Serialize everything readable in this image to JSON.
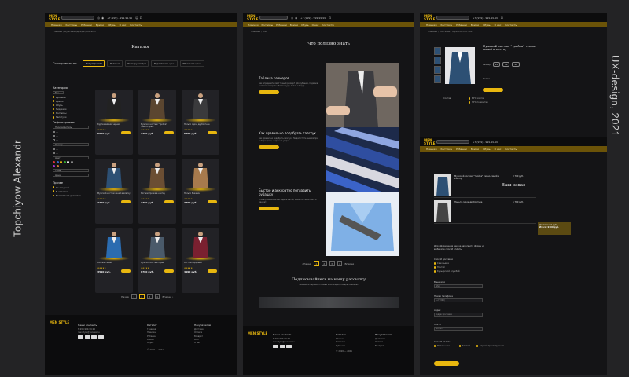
{
  "author": "Topchiyow Alexandr",
  "caption": "UX-design, 2021",
  "header": {
    "logo": "MEN STYLE",
    "phone": "+7 (999) - 999-99-99",
    "nav": [
      "Новинки",
      "Костюмы",
      "Рубашки",
      "Брюки",
      "Обувь",
      "О нас",
      "Контакты"
    ]
  },
  "catalog": {
    "breadcrumb": "Главная  /  Мужская одежда  /  Каталог",
    "title": "Каталог",
    "sort_label": "Сортировать по:",
    "sort_options": [
      "Популярности",
      "Новизне",
      "Размеру скидки",
      "Нарастанию цены",
      "Убыванию цены"
    ],
    "filters": {
      "category_title": "Категория",
      "categories": [
        "Все",
        "Рубашки",
        "Брюки",
        "Обувь",
        "Пиджаки",
        "Костюмы",
        "Галстуки"
      ],
      "sort_title": "Отфильтровать",
      "blocks": [
        "Производитель",
        "Размер",
        "Цвет",
        "Ткань",
        "Цена"
      ],
      "extra_title": "Прочее",
      "extra": [
        "Со скидкой",
        "В наличии",
        "Бесплатная доставка"
      ]
    },
    "products": [
      {
        "name": "Куртка зимняя черная",
        "price": "5690 руб."
      },
      {
        "name": "Мужской костюм \"тройка\" темно-серый",
        "price": "3200 руб."
      },
      {
        "name": "Пальто серое двубортное",
        "price": "5490 руб."
      },
      {
        "name": "Мужской костюм синий в клетку",
        "price": "4490 руб."
      },
      {
        "name": "Костюм тройка в клетку",
        "price": "3790 руб."
      },
      {
        "name": "Пальто бежевое",
        "price": "3790 руб."
      },
      {
        "name": "Костюм синий",
        "price": "3590 руб."
      },
      {
        "name": "Мужской костюм серый",
        "price": "8790 руб."
      },
      {
        "name": "Костюм бордовый",
        "price": "4990 руб."
      }
    ],
    "pager": {
      "prev": "Назад",
      "pages": [
        "1",
        "2",
        "3",
        "4"
      ],
      "active": "2",
      "next": "Вперед"
    }
  },
  "knowledge": {
    "breadcrumb": "Главная  /  Блог",
    "title": "Что полезно знать",
    "articles": [
      {
        "title": "Таблица размеров",
        "text": "Как определить свой точный размер? Для рубашки, пиджака, костюма измерьте обхват груди, талии и бедер.",
        "button": "Подробнее"
      },
      {
        "title": "Как правильно подобрать галстук",
        "text": "Как правильно подобрать галстук? Не допустите ошибок при выборе цвета, ширины и узора.",
        "button": "Подробнее"
      },
      {
        "title": "Быстро и аккуратно погладить рубашку",
        "text": "Чтобы рубашка не выглядела мятой, начните с воротника и манжет.",
        "button": "Подробнее"
      }
    ],
    "pager": {
      "prev": "Назад",
      "pages": [
        "1",
        "2",
        "3",
        "4"
      ],
      "next": "Вперед"
    },
    "subscribe_title": "Подписывайтесь на нашу рассылку",
    "subscribe_text": "Узнавайте первыми о новых коллекциях, скидках и акциях"
  },
  "product": {
    "breadcrumb": "Главная  /  Костюмы  /  Мужской костюм",
    "name": "Мужской костюм \"тройка\" темно-синий в клетку",
    "size_label": "Размер",
    "sizes": [
      "44",
      "46",
      "48"
    ],
    "qty_label": "Кол-во",
    "composition_label": "Состав",
    "composition": [
      "65% хлопок",
      "35% полиэстер"
    ]
  },
  "order": {
    "title": "Ваш заказ",
    "items": [
      {
        "name": "Мужской костюм \"тройка\" темно-синий в клетку",
        "price": "3 700 руб."
      },
      {
        "name": "Пальто серое двубортное",
        "price": "5 760 руб."
      }
    ],
    "delivery": "Доставка: 0 руб.",
    "total": "Итого: 9460 руб.",
    "form_intro": "Для оформления заказа заполните форму и выберите способ оплаты",
    "delivery_title": "Способ доставки",
    "delivery_options": [
      "Самовывоз",
      "Почтой",
      "Курьерской службой"
    ],
    "fields": [
      {
        "label": "Ваше имя",
        "placeholder": "Имя"
      },
      {
        "label": "Номер телефона",
        "placeholder": "+7 (999)"
      },
      {
        "label": "Адрес",
        "placeholder": "Адрес доставки"
      },
      {
        "label": "Почта",
        "placeholder": "e-mail"
      }
    ],
    "payment_title": "Способ оплаты",
    "payment_options": [
      "Наличными",
      "Картой",
      "Картой при получении"
    ]
  },
  "footer": {
    "contacts_title": "Наши контакты",
    "phone": "8-999-999-99-99",
    "email": "menstyle@yandex.ru",
    "catalog_title": "Каталог",
    "catalog_items": [
      "Главная",
      "Новинки",
      "Рубашки",
      "Брюки",
      "Обувь"
    ],
    "info_title": "Покупателям",
    "info_items": [
      "Доставка",
      "Оплата",
      "Возврат",
      "Блог",
      "О нас"
    ],
    "copyright": "© 2020 — 2021"
  }
}
